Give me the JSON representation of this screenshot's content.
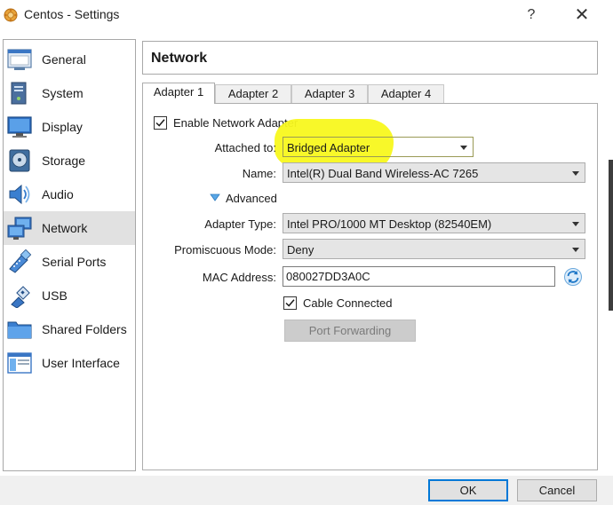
{
  "window": {
    "title": "Centos - Settings",
    "help_label": "?",
    "close_label": "✕"
  },
  "sidebar": {
    "items": [
      {
        "label": "General",
        "icon": "general-icon"
      },
      {
        "label": "System",
        "icon": "system-icon"
      },
      {
        "label": "Display",
        "icon": "display-icon"
      },
      {
        "label": "Storage",
        "icon": "storage-icon"
      },
      {
        "label": "Audio",
        "icon": "audio-icon"
      },
      {
        "label": "Network",
        "icon": "network-icon",
        "selected": true
      },
      {
        "label": "Serial Ports",
        "icon": "serial-ports-icon"
      },
      {
        "label": "USB",
        "icon": "usb-icon"
      },
      {
        "label": "Shared Folders",
        "icon": "shared-folders-icon"
      },
      {
        "label": "User Interface",
        "icon": "user-interface-icon"
      }
    ]
  },
  "header": {
    "title": "Network"
  },
  "tabs": [
    {
      "label": "Adapter 1",
      "active": true
    },
    {
      "label": "Adapter 2"
    },
    {
      "label": "Adapter 3"
    },
    {
      "label": "Adapter 4"
    }
  ],
  "adapter": {
    "enable_label": "Enable Network Adapter",
    "enable_checked": true,
    "attached_label": "Attached to:",
    "attached_value": "Bridged Adapter",
    "name_label": "Name:",
    "name_value": "Intel(R) Dual Band Wireless-AC 7265",
    "advanced_label": "Advanced",
    "adapter_type_label": "Adapter Type:",
    "adapter_type_value": "Intel PRO/1000 MT Desktop (82540EM)",
    "promiscuous_label": "Promiscuous Mode:",
    "promiscuous_value": "Deny",
    "mac_label": "MAC Address:",
    "mac_value": "080027DD3A0C",
    "cable_label": "Cable Connected",
    "cable_checked": true,
    "port_forwarding_label": "Port Forwarding"
  },
  "footer": {
    "ok_label": "OK",
    "cancel_label": "Cancel"
  },
  "colors": {
    "highlight": "#f8f81e",
    "accent": "#0078d7",
    "selected_bg": "#e1e1e1"
  }
}
